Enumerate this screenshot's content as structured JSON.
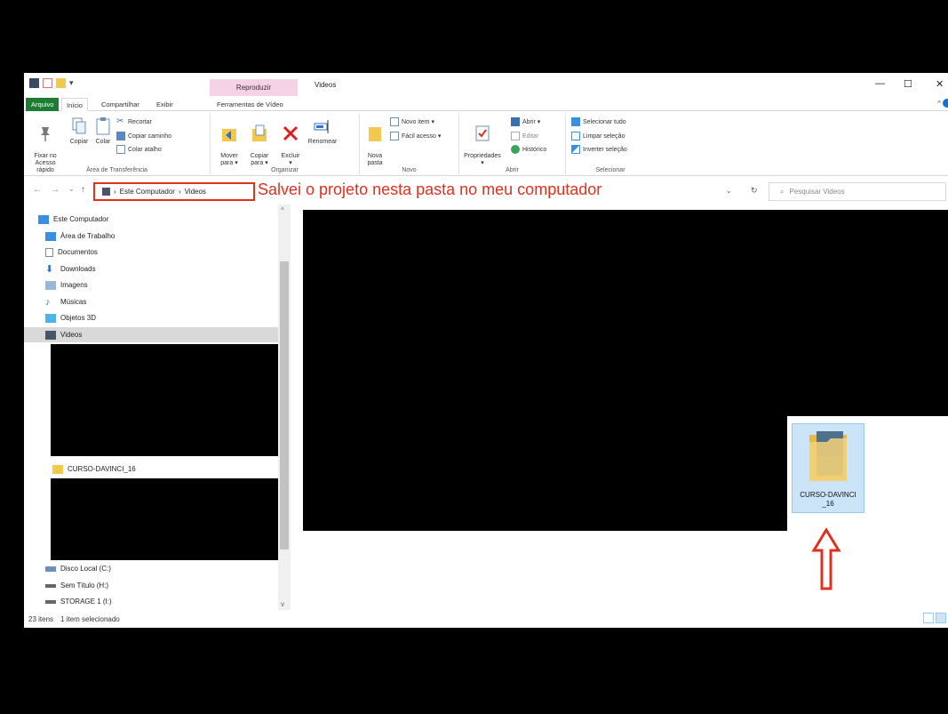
{
  "window": {
    "title": "Videos",
    "context_tab": "Reproduzir",
    "minimize": "—",
    "maximize": "☐",
    "close": "✕"
  },
  "ribbon_tabs": [
    "Arquivo",
    "Início",
    "Compartilhar",
    "Exibir",
    "Ferramentas de Vídeo"
  ],
  "ribbon": {
    "clipboard": {
      "label": "Área de Transferência",
      "pin": "Fixar no\nAcesso rápido",
      "copy": "Copiar",
      "paste": "Colar",
      "cut": "Recortar",
      "copy_path": "Copiar caminho",
      "paste_shortcut": "Colar atalho"
    },
    "organize": {
      "label": "Organizar",
      "move_to": "Mover\npara ▾",
      "copy_to": "Copiar\npara ▾",
      "delete": "Excluir\n▾",
      "rename": "Renomear"
    },
    "new": {
      "label": "Novo",
      "new_folder": "Nova\npasta",
      "new_item": "Novo item ▾",
      "easy_access": "Fácil acesso ▾"
    },
    "open": {
      "label": "Abrir",
      "properties": "Propriedades\n▾",
      "open": "Abrir ▾",
      "edit": "Editar",
      "history": "Histórico"
    },
    "select": {
      "label": "Selecionar",
      "select_all": "Selecionar tudo",
      "select_none": "Limpar seleção",
      "invert": "Inverter seleção"
    }
  },
  "address": {
    "back": "←",
    "forward": "→",
    "recent": "⌄",
    "up": "↑",
    "sep": "›",
    "crumbs": [
      "Este Computador",
      "Videos"
    ],
    "dropdown": "⌄",
    "refresh": "↻",
    "search_placeholder": "Pesquisar Videos",
    "search_icon": "⌕"
  },
  "annotation": {
    "text": "Salvei o projeto nesta pasta no meu computador",
    "color": "#e0301e"
  },
  "nav": {
    "items": [
      {
        "label": "Este Computador",
        "icon": "computer-icon"
      },
      {
        "label": "Área de Trabalho",
        "icon": "desktop-icon"
      },
      {
        "label": "Documentos",
        "icon": "documents-icon"
      },
      {
        "label": "Downloads",
        "icon": "downloads-icon"
      },
      {
        "label": "Imagens",
        "icon": "pictures-icon"
      },
      {
        "label": "Músicas",
        "icon": "music-icon"
      },
      {
        "label": "Objetos 3D",
        "icon": "objects3d-icon"
      },
      {
        "label": "Videos",
        "icon": "videos-icon"
      },
      {
        "label": "CURSO-DAVINCI_16",
        "icon": "folder-icon"
      },
      {
        "label": "Disco Local (C:)",
        "icon": "drive-icon"
      },
      {
        "label": "Sem Título (H:)",
        "icon": "drive-icon"
      },
      {
        "label": "STORAGE 1 (I:)",
        "icon": "drive-icon"
      }
    ]
  },
  "content": {
    "folder_name": "CURSO-DAVINCI\n_16"
  },
  "status": {
    "items_count": "23 itens",
    "selected": "1 item selecionado"
  },
  "colors": {
    "accent": "#1e7b34",
    "selection": "#cce4f7",
    "highlight": "#e0301e"
  }
}
